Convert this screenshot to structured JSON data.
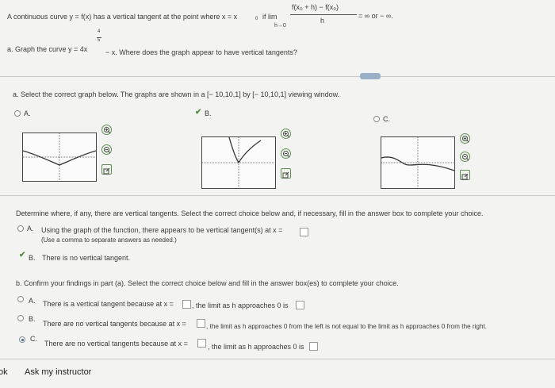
{
  "definition": {
    "prefix": "A continuous curve y = f(x) has a vertical tangent at the point where x = x",
    "sub0": "0",
    "if_lim": "if  lim",
    "h_to_0": "h→0",
    "numerator": "f(x₀ + h) − f(x₀)",
    "denominator": "h",
    "result": "= ∞ or − ∞."
  },
  "part_a": {
    "question": "a. Graph the curve y = 4x",
    "exponent_num": "4",
    "exponent_den": "5",
    "question_rest": "− x. Where does the graph appear to have vertical tangents?",
    "select_prompt": "a. Select the correct graph below. The graphs are shown in a [− 10,10,1] by [− 10,10,1] viewing window.",
    "option_a": "A.",
    "option_b": "B.",
    "option_c": "C."
  },
  "determine": {
    "prompt": "Determine where, if any, there are vertical tangents. Select the correct choice below and, if necessary, fill in the answer box to complete your choice.",
    "opt_a_letter": "A.",
    "opt_a_text": "Using the graph of the function, there appears to be vertical tangent(s) at x =",
    "opt_a_note": "(Use a comma to separate answers as needed.)",
    "opt_b_letter": "B.",
    "opt_b_text": "There is no vertical tangent."
  },
  "part_b": {
    "prompt": "b. Confirm your findings in part (a). Select the correct choice below and fill in the answer box(es) to complete your choice.",
    "opt_a_letter": "A.",
    "opt_a_text1": "There is a vertical tangent because at x =",
    "opt_a_text2": ", the limit as h approaches 0 is",
    "opt_b_letter": "B.",
    "opt_b_text1": "There are no vertical tangents because at x =",
    "opt_b_text2": ", the limit as h approaches 0 from the left is not equal to the limit as h approaches 0 from the right.",
    "opt_c_letter": "C.",
    "opt_c_text1": "There are no vertical tangents because at x =",
    "opt_c_text2": ", the limit as h approaches 0 is"
  },
  "footer": {
    "ok_fragment": "ok",
    "ask_instructor": "Ask my instructor"
  },
  "icons": {
    "zoom_in": "zoom-in-icon",
    "zoom_out": "zoom-out-icon",
    "expand": "expand-icon"
  },
  "colors": {
    "selected_check": "#4f8f3e",
    "selected_radio": "#2a6fb0",
    "icon_green": "#5f8f52"
  }
}
